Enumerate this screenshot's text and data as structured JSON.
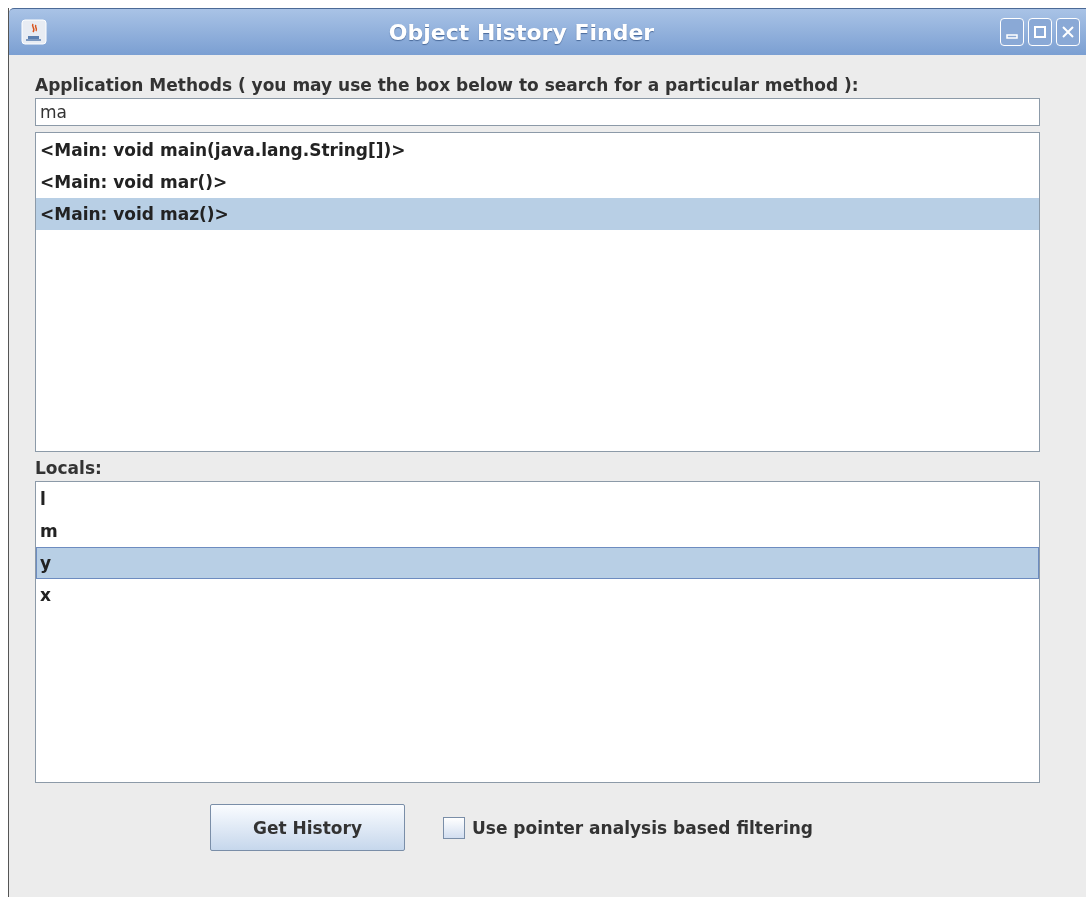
{
  "window": {
    "title": "Object History Finder"
  },
  "methods_label": "Application Methods ( you may use the box below to search for a particular method ):",
  "search": {
    "value": "ma"
  },
  "methods": [
    {
      "label": "<Main: void main(java.lang.String[])>",
      "selected": false
    },
    {
      "label": "<Main: void mar()>",
      "selected": false
    },
    {
      "label": "<Main: void maz()>",
      "selected": true
    }
  ],
  "locals_label": "Locals:",
  "locals": [
    {
      "label": "l",
      "selected": false
    },
    {
      "label": "m",
      "selected": false
    },
    {
      "label": "y",
      "selected": true
    },
    {
      "label": "x",
      "selected": false
    }
  ],
  "button": "Get History",
  "checkbox": {
    "label": "Use pointer analysis based filtering",
    "checked": false
  }
}
